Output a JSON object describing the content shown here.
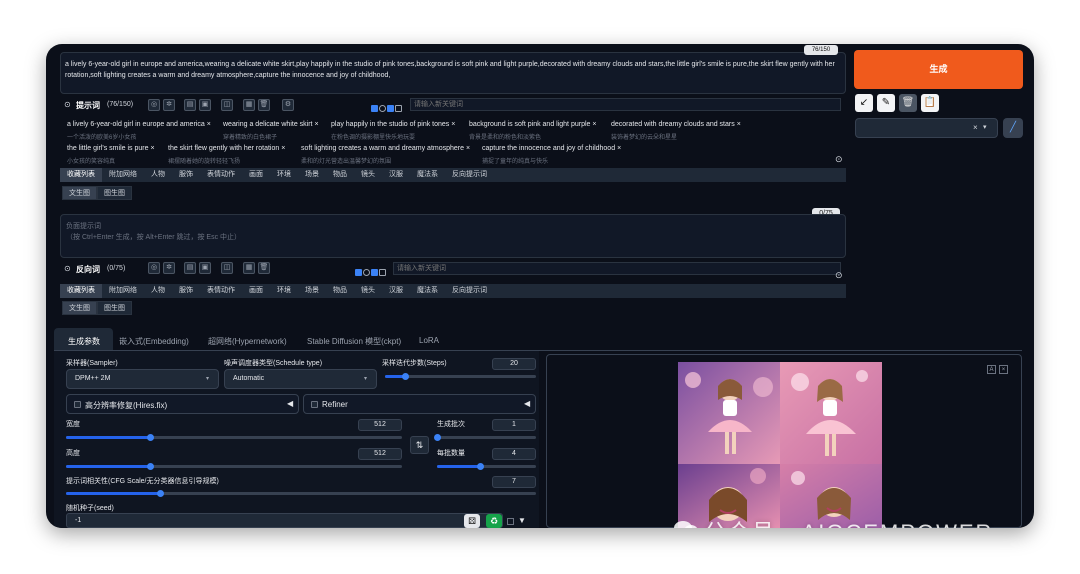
{
  "prompt": {
    "text": "a lively 6-year-old girl in europe and america,wearing a delicate white skirt,play happily in the studio of pink tones,background is soft pink and light purple,decorated with dreamy clouds and stars,the little girl's smile is pure,the skirt flew gently with her rotation,soft lighting creates a warm and dreamy atmosphere,capture the innocence and joy of childhood,",
    "corner_counter": "76/150",
    "label": "提示词",
    "count": "(76/150)",
    "keyword_placeholder": "请输入新关键词"
  },
  "tags": [
    {
      "en": "a lively 6-year-old girl in europe and america",
      "zh": "一个活泼的欧美6岁小女孩"
    },
    {
      "en": "wearing a delicate white skirt",
      "zh": "穿着精致的白色裙子"
    },
    {
      "en": "play happily in the studio of pink tones",
      "zh": "在粉色调的摄影棚里快乐地玩耍"
    },
    {
      "en": "background is soft pink and light purple",
      "zh": "背景是柔和的粉色和淡紫色"
    },
    {
      "en": "decorated with dreamy clouds and stars",
      "zh": "装饰着梦幻的云朵和星星"
    },
    {
      "en": "the little girl's smile is pure",
      "zh": "小女孩的笑容纯真"
    },
    {
      "en": "the skirt flew gently with her rotation",
      "zh": "裙摆随着她的旋转轻轻飞扬"
    },
    {
      "en": "soft lighting creates a warm and dreamy atmosphere",
      "zh": "柔和的灯光营造出温馨梦幻的氛围"
    },
    {
      "en": "capture the innocence and joy of childhood",
      "zh": "捕捉了童年的纯真与快乐"
    }
  ],
  "category_tabs": [
    "收藏列表",
    "附加网络",
    "人物",
    "服饰",
    "表情动作",
    "画面",
    "环境",
    "场景",
    "物品",
    "镜头",
    "汉服",
    "魔法系",
    "反向提示词"
  ],
  "sub_tabs": [
    "文生图",
    "图生图"
  ],
  "negative": {
    "corner_counter": "0/75",
    "placeholder_line1": "负面提示词",
    "placeholder_line2": "（按 Ctrl+Enter 生成，按 Alt+Enter 跳过，按 Esc 中止）",
    "label": "反向词",
    "count": "(0/75)",
    "keyword_placeholder": "请输入新关键词"
  },
  "generate_label": "生成",
  "style_select_symbols": {
    "clear": "×",
    "dropdown": "▾"
  },
  "main_tabs": [
    "生成参数",
    "嵌入式(Embedding)",
    "超网络(Hypernetwork)",
    "Stable Diffusion 模型(ckpt)",
    "LoRA"
  ],
  "params": {
    "sampler_label": "采样器(Sampler)",
    "sampler_value": "DPM++ 2M",
    "schedule_label": "噪声调度器类型(Schedule type)",
    "schedule_value": "Automatic",
    "steps_label": "采样迭代步数(Steps)",
    "steps_value": "20",
    "steps_fraction": 0.13,
    "hires_label": "高分辨率修复(Hires.fix)",
    "refiner_label": "Refiner",
    "width_label": "宽度",
    "width_value": "512",
    "width_fraction": 0.25,
    "height_label": "高度",
    "height_value": "512",
    "height_fraction": 0.25,
    "batch_count_label": "生成批次",
    "batch_count_value": "1",
    "batch_count_fraction": 0.0,
    "batch_size_label": "每批数量",
    "batch_size_value": "4",
    "batch_size_fraction": 0.43,
    "cfg_label": "提示词相关性(CFG Scale/无分类器信息引导规模)",
    "cfg_value": "7",
    "cfg_fraction": 0.2,
    "seed_label": "随机种子(seed)",
    "seed_value": "-1"
  },
  "watermark": "公众号 · AIGCEMPOWER",
  "colors": {
    "background": "#0b0f19",
    "panel": "#1f2937",
    "generate": "#f05a1c",
    "accent": "#2563eb"
  }
}
